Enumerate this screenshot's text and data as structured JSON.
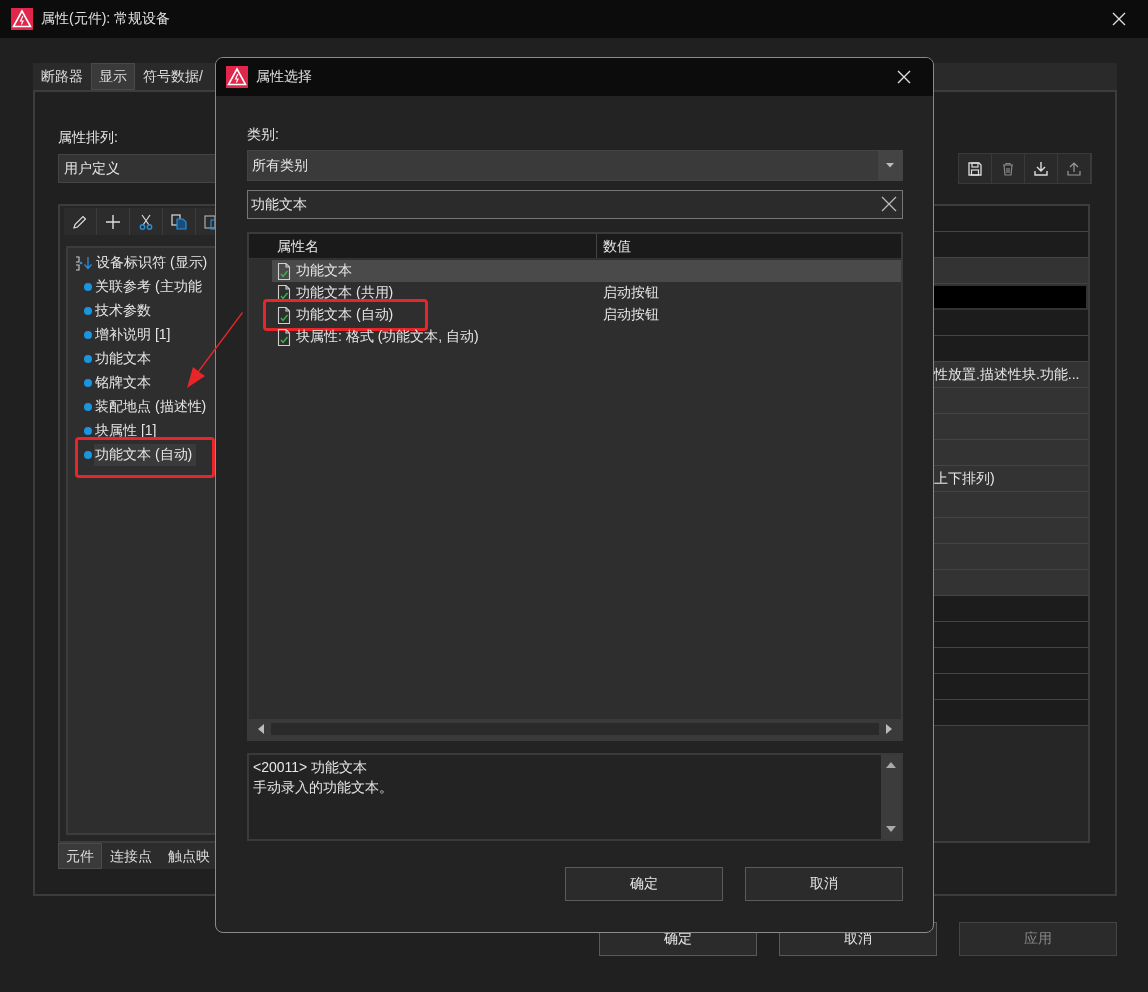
{
  "window": {
    "title": "属性(元件): 常规设备"
  },
  "tabs": [
    {
      "label": "断路器",
      "selected": false
    },
    {
      "label": "显示",
      "selected": true
    },
    {
      "label": "符号数据/",
      "selected": false
    }
  ],
  "sort_label": "属性排列:",
  "sort_dropdown": {
    "value": "用户定义"
  },
  "tree": [
    {
      "label": "设备标识符 (显示)",
      "kind": "header",
      "selected": false,
      "highlighted": false
    },
    {
      "label": "关联参考 (主功能",
      "kind": "item",
      "selected": false,
      "highlighted": false
    },
    {
      "label": "技术参数",
      "kind": "item",
      "selected": false,
      "highlighted": false
    },
    {
      "label": "增补说明 [1]",
      "kind": "item",
      "selected": false,
      "highlighted": false
    },
    {
      "label": "功能文本",
      "kind": "item",
      "selected": false,
      "highlighted": false
    },
    {
      "label": "铭牌文本",
      "kind": "item",
      "selected": false,
      "highlighted": false
    },
    {
      "label": "装配地点 (描述性)",
      "kind": "item",
      "selected": false,
      "highlighted": false
    },
    {
      "label": "块属性 [1]",
      "kind": "item",
      "selected": false,
      "highlighted": false
    },
    {
      "label": "功能文本 (自动)",
      "kind": "item",
      "selected": true,
      "highlighted": true
    }
  ],
  "bottom_tabs": [
    {
      "label": "元件",
      "selected": true
    },
    {
      "label": "连接点",
      "selected": false
    },
    {
      "label": "触点映",
      "selected": false
    }
  ],
  "property_grid": [
    {
      "kind": "dark"
    },
    {
      "kind": "dark"
    },
    {
      "kind": "light"
    },
    {
      "kind": "input"
    },
    {
      "kind": "dark"
    },
    {
      "kind": "dark"
    },
    {
      "kind": "light",
      "value": "性放置.描述性块.功能..."
    },
    {
      "kind": "light"
    },
    {
      "kind": "light"
    },
    {
      "kind": "light"
    },
    {
      "kind": "light",
      "value": "上下排列)"
    },
    {
      "kind": "light"
    },
    {
      "kind": "light"
    },
    {
      "kind": "light"
    },
    {
      "kind": "light"
    },
    {
      "kind": "dark"
    },
    {
      "kind": "dark"
    },
    {
      "kind": "dark"
    },
    {
      "kind": "dark"
    },
    {
      "kind": "dark"
    }
  ],
  "buttons": [
    {
      "label": "确定",
      "disabled": false
    },
    {
      "label": "取消",
      "disabled": false
    },
    {
      "label": "应用",
      "disabled": true
    }
  ],
  "dialog": {
    "title": "属性选择",
    "category_label": "类别:",
    "category": {
      "value": "所有类别"
    },
    "search": {
      "value": "功能文本"
    },
    "columns": [
      "属性名",
      "数值"
    ],
    "rows": [
      {
        "name": "功能文本",
        "selected": true,
        "highlighted": false
      },
      {
        "name": "功能文本 (共用)",
        "value": "启动按钮",
        "selected": false,
        "highlighted": false
      },
      {
        "name": "功能文本 (自动)",
        "value": "启动按钮",
        "selected": false,
        "highlighted": true
      },
      {
        "name": "块属性: 格式 (功能文本, 自动)",
        "selected": false,
        "highlighted": false
      }
    ],
    "description": [
      "<20011> 功能文本",
      "手动录入的功能文本。"
    ],
    "buttons": [
      {
        "label": "确定"
      },
      {
        "label": "取消"
      }
    ]
  },
  "annotation_arrow": true
}
